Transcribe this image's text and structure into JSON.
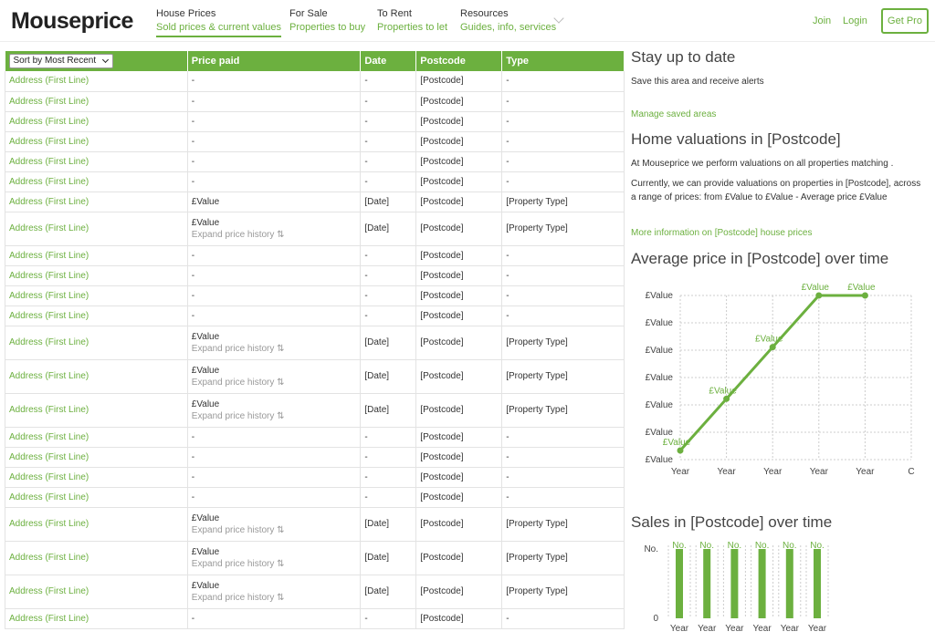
{
  "header": {
    "logo": "Mouseprice",
    "nav": [
      {
        "top": "House Prices",
        "sub": "Sold prices & current values"
      },
      {
        "top": "For Sale",
        "sub": "Properties to buy"
      },
      {
        "top": "To Rent",
        "sub": "Properties to let"
      },
      {
        "top": "Resources",
        "sub": "Guides, info, services"
      }
    ],
    "join": "Join",
    "login": "Login",
    "getpro": "Get Pro"
  },
  "table": {
    "sort_label": "Sort by Most Recent",
    "columns": [
      "Price paid",
      "Date",
      "Postcode",
      "Type"
    ],
    "expand_label": "Expand price history",
    "rows": [
      {
        "address": "Address (First Line)",
        "price": "-",
        "date": "-",
        "postcode": "[Postcode]",
        "type": "-",
        "expand": false
      },
      {
        "address": "Address (First Line)",
        "price": "-",
        "date": "-",
        "postcode": "[Postcode]",
        "type": "-",
        "expand": false
      },
      {
        "address": "Address (First Line)",
        "price": "-",
        "date": "-",
        "postcode": "[Postcode]",
        "type": "-",
        "expand": false
      },
      {
        "address": "Address (First Line)",
        "price": "-",
        "date": "-",
        "postcode": "[Postcode]",
        "type": "-",
        "expand": false
      },
      {
        "address": "Address (First Line)",
        "price": "-",
        "date": "-",
        "postcode": "[Postcode]",
        "type": "-",
        "expand": false
      },
      {
        "address": "Address (First Line)",
        "price": "-",
        "date": "-",
        "postcode": "[Postcode]",
        "type": "-",
        "expand": false
      },
      {
        "address": "Address (First Line)",
        "price": "£Value",
        "date": "[Date]",
        "postcode": "[Postcode]",
        "type": "[Property Type]",
        "expand": false
      },
      {
        "address": "Address (First Line)",
        "price": "£Value",
        "date": "[Date]",
        "postcode": "[Postcode]",
        "type": "[Property Type]",
        "expand": true
      },
      {
        "address": "Address (First Line)",
        "price": "-",
        "date": "-",
        "postcode": "[Postcode]",
        "type": "-",
        "expand": false
      },
      {
        "address": "Address (First Line)",
        "price": "-",
        "date": "-",
        "postcode": "[Postcode]",
        "type": "-",
        "expand": false
      },
      {
        "address": "Address (First Line)",
        "price": "-",
        "date": "-",
        "postcode": "[Postcode]",
        "type": "-",
        "expand": false
      },
      {
        "address": "Address (First Line)",
        "price": "-",
        "date": "-",
        "postcode": "[Postcode]",
        "type": "-",
        "expand": false
      },
      {
        "address": "Address (First Line)",
        "price": "£Value",
        "date": "[Date]",
        "postcode": "[Postcode]",
        "type": "[Property Type]",
        "expand": true
      },
      {
        "address": "Address (First Line)",
        "price": "£Value",
        "date": "[Date]",
        "postcode": "[Postcode]",
        "type": "[Property Type]",
        "expand": true
      },
      {
        "address": "Address (First Line)",
        "price": "£Value",
        "date": "[Date]",
        "postcode": "[Postcode]",
        "type": "[Property Type]",
        "expand": true
      },
      {
        "address": "Address (First Line)",
        "price": "-",
        "date": "-",
        "postcode": "[Postcode]",
        "type": "-",
        "expand": false
      },
      {
        "address": "Address (First Line)",
        "price": "-",
        "date": "-",
        "postcode": "[Postcode]",
        "type": "-",
        "expand": false
      },
      {
        "address": "Address (First Line)",
        "price": "-",
        "date": "-",
        "postcode": "[Postcode]",
        "type": "-",
        "expand": false
      },
      {
        "address": "Address (First Line)",
        "price": "-",
        "date": "-",
        "postcode": "[Postcode]",
        "type": "-",
        "expand": false
      },
      {
        "address": "Address (First Line)",
        "price": "£Value",
        "date": "[Date]",
        "postcode": "[Postcode]",
        "type": "[Property Type]",
        "expand": true
      },
      {
        "address": "Address (First Line)",
        "price": "£Value",
        "date": "[Date]",
        "postcode": "[Postcode]",
        "type": "[Property Type]",
        "expand": true
      },
      {
        "address": "Address (First Line)",
        "price": "£Value",
        "date": "[Date]",
        "postcode": "[Postcode]",
        "type": "[Property Type]",
        "expand": true
      },
      {
        "address": "Address (First Line)",
        "price": "-",
        "date": "-",
        "postcode": "[Postcode]",
        "type": "-",
        "expand": false
      }
    ]
  },
  "sidebar": {
    "stay_title": "Stay up to date",
    "stay_text": "Save this area and receive alerts",
    "manage_link": "Manage saved areas",
    "val_title": "Home valuations in [Postcode]",
    "val_text1": "At Mouseprice we perform valuations on all properties matching .",
    "val_text2": "Currently, we can provide valuations on properties in [Postcode], across a range of prices: from £Value to £Value - Average price £Value",
    "more_link": "More information on [Postcode] house prices",
    "avg_title": "Average price in [Postcode] over time",
    "sales_title": "Sales in [Postcode] over time"
  },
  "colors": {
    "accent": "#6cb03f"
  },
  "chart_data": [
    {
      "type": "line",
      "title": "Average price in [Postcode] over time",
      "y_tick_labels": [
        "£Value",
        "£Value",
        "£Value",
        "£Value",
        "£Value",
        "£Value",
        "£Value"
      ],
      "x_tick_labels": [
        "Year",
        "Year",
        "Year",
        "Year",
        "Year",
        "C"
      ],
      "point_labels": [
        "£Value",
        "£Value",
        "£Value",
        "£Value",
        "£Value"
      ],
      "x": [
        0,
        1,
        2,
        3,
        4
      ],
      "values": [
        1,
        2.7,
        4.4,
        6.1,
        6.1
      ],
      "ylim": [
        0.7,
        6.1
      ],
      "grid": true
    },
    {
      "type": "bar",
      "title": "Sales in [Postcode] over time",
      "y_tick_labels": [
        "No.",
        "0"
      ],
      "categories": [
        "Year",
        "Year",
        "Year",
        "Year",
        "Year",
        "Year"
      ],
      "data_labels": [
        "No.",
        "No.",
        "No.",
        "No.",
        "No.",
        "No."
      ],
      "values": [
        1,
        1,
        1,
        1,
        1,
        1
      ],
      "ylim": [
        0,
        1
      ]
    }
  ]
}
